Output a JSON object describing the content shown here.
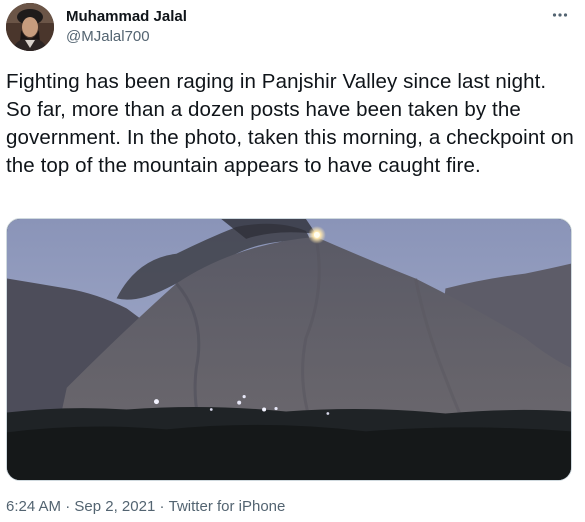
{
  "author": {
    "name": "Muhammad Jalal",
    "handle": "@MJalal700"
  },
  "tweet": {
    "text": "Fighting has been raging in Panjshir Valley since last night. So far, more than a dozen posts have been taken by the government. In the photo, taken this morning, a checkpoint on the top of the mountain appears to have caught fire."
  },
  "meta": {
    "time": "6:24 AM",
    "date": "Sep 2, 2021",
    "separator": "·",
    "source": "Twitter for iPhone"
  },
  "icons": {
    "more": "more-horizontal-icon"
  },
  "colors": {
    "text": "#0f1419",
    "secondary": "#536471",
    "border": "#cfd9de"
  }
}
